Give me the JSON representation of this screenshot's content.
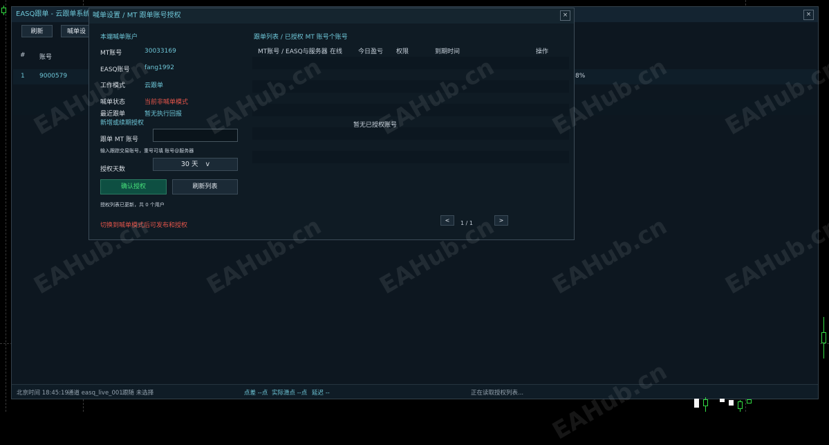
{
  "main_window": {
    "title": "EASQ跟单 - 云跟单系统",
    "close_label": "×",
    "toolbar": {
      "refresh_label": "刷新",
      "settings_label": "喊单设"
    },
    "table": {
      "headers": [
        "#",
        "账号"
      ],
      "rows": [
        {
          "index": "1",
          "account": "9000579",
          "trailing_fragment": "8%"
        }
      ]
    },
    "status_bar": {
      "time_text": "北京时间 18:45:19",
      "channel_text": "通道 easq_live_001",
      "follow_text": "跟随 未选择",
      "slippage_text": "点差 --点",
      "actual_slippage_text": "实际滑点 --点",
      "latency_text": "延迟 --",
      "loading_text": "正在读取授权列表..."
    }
  },
  "dialog": {
    "title": "喊单设置 / MT 跟单账号授权",
    "close_label": "×",
    "left": {
      "section_title": "本端喊单账户",
      "fields": [
        {
          "label": "MT账号",
          "value": "30033169",
          "color": "cyan"
        },
        {
          "label": "EASQ账号",
          "value": "fang1992",
          "color": "cyan"
        },
        {
          "label": "工作模式",
          "value": "云跟单",
          "color": "cyan"
        },
        {
          "label": "喊单状态",
          "value": "当前非喊单模式",
          "color": "red"
        },
        {
          "label": "最近跟单",
          "value": "暂无执行回报",
          "color": "cyan"
        }
      ],
      "add_section_title": "新增或续期授权",
      "mt_account_label": "跟单 MT 账号",
      "mt_account_value": "",
      "mt_account_hint": "输入跟踪交易账号，重号可填 账号@服务器",
      "days_label": "授权天数",
      "days_value": "30 天",
      "days_chevron": "v",
      "confirm_label": "确认授权",
      "refresh_list_label": "刷新列表",
      "list_status": "授权列表已更新，共 0 个用户",
      "warning": "切换到喊单模式后可发布和授权"
    },
    "right": {
      "section_title": "跟单列表 / 已授权 MT 账号个账号",
      "headers": [
        "MT账号 / EASQ与服务器",
        "在线",
        "今日盈亏",
        "权限",
        "到期时间",
        "操作"
      ],
      "empty_text": "暂无已授权账号",
      "prev_label": "<",
      "page_text": "1 / 1",
      "next_label": ">"
    }
  },
  "watermark": "EAHub.cn",
  "colors": {
    "accent": "#6ec6d7",
    "warning": "#e2544a",
    "confirm": "#46e07a",
    "background": "#0d1720"
  }
}
